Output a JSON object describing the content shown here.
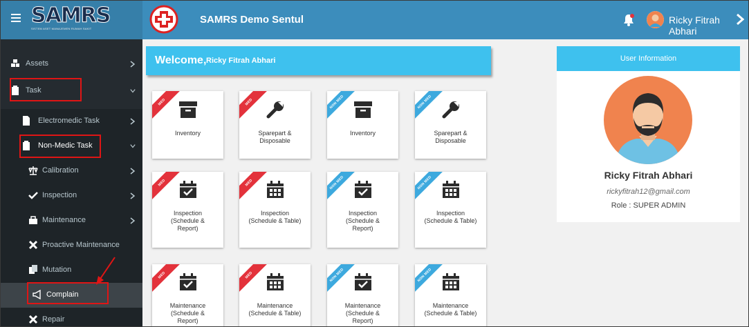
{
  "brand": {
    "logo_text": "SAMRS",
    "logo_tagline": "SISTEM ASET MANAJEMEN RUMAH SAKIT"
  },
  "header": {
    "app_title": "SAMRS Demo Sentul",
    "user_name": "Ricky Fitrah Abhari"
  },
  "sidebar": {
    "items": [
      {
        "label": "Assets"
      },
      {
        "label": "Task"
      },
      {
        "label": "Electromedic Task"
      },
      {
        "label": "Non-Medic Task"
      },
      {
        "label": "Calibration"
      },
      {
        "label": "Inspection"
      },
      {
        "label": "Maintenance"
      },
      {
        "label": "Proactive Maintenance"
      },
      {
        "label": "Mutation"
      },
      {
        "label": "Complain"
      },
      {
        "label": "Repair"
      }
    ]
  },
  "welcome": {
    "greeting": "Welcome,",
    "name": "Ricky Fitrah Abhari"
  },
  "tiles": [
    {
      "ribbon": "MED",
      "lines": [
        "Inventory"
      ]
    },
    {
      "ribbon": "MED",
      "lines": [
        "Sparepart &",
        "Disposable"
      ]
    },
    {
      "ribbon": "NON MED",
      "lines": [
        "Inventory"
      ]
    },
    {
      "ribbon": "NON MED",
      "lines": [
        "Sparepart &",
        "Disposable"
      ]
    },
    {
      "ribbon": "MED",
      "lines": [
        "Inspection",
        "(Schedule &",
        "Report)"
      ]
    },
    {
      "ribbon": "MED",
      "lines": [
        "Inspection",
        "(Schedule & Table)"
      ]
    },
    {
      "ribbon": "NON MED",
      "lines": [
        "Inspection",
        "(Schedule &",
        "Report)"
      ]
    },
    {
      "ribbon": "NON MED",
      "lines": [
        "Inspection",
        "(Schedule & Table)"
      ]
    },
    {
      "ribbon": "MED",
      "lines": [
        "Maintenance",
        "(Schedule &",
        "Report)"
      ]
    },
    {
      "ribbon": "MED",
      "lines": [
        "Maintenance",
        "(Schedule & Table)"
      ]
    },
    {
      "ribbon": "NON MED",
      "lines": [
        "Maintenance",
        "(Schedule &",
        "Report)"
      ]
    },
    {
      "ribbon": "NON MED",
      "lines": [
        "Maintenance",
        "(Schedule & Table)"
      ]
    }
  ],
  "user_card": {
    "header": "User Information",
    "name": "Ricky Fitrah Abhari",
    "email": "rickyfitrah12@gmail.com",
    "role": "Role : SUPER ADMIN"
  },
  "colors": {
    "topbar": "#3c8dbc",
    "sidebar": "#252b30",
    "accent": "#3ec1ee",
    "med": "#e3323b",
    "nonmed": "#3da9de",
    "highlight": "#e01515"
  }
}
